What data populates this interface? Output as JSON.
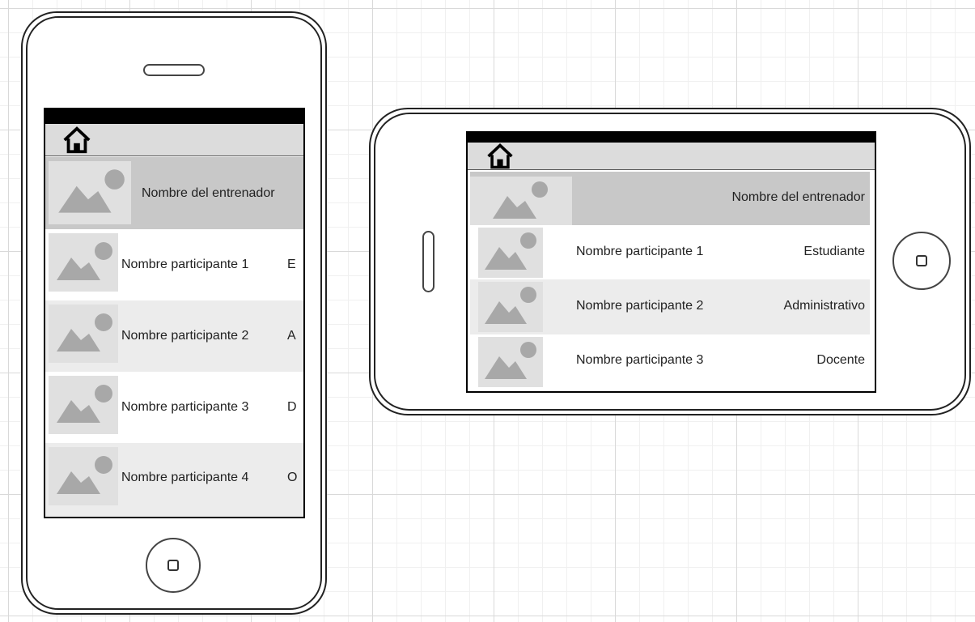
{
  "portrait": {
    "header": {
      "home_icon": "home-icon"
    },
    "trainer": {
      "name": "Nombre del entrenador"
    },
    "participants": [
      {
        "name": "Nombre participante 1",
        "role": "E"
      },
      {
        "name": "Nombre participante 2",
        "role": "A"
      },
      {
        "name": "Nombre participante 3",
        "role": "D"
      },
      {
        "name": "Nombre participante 4",
        "role": "O"
      }
    ]
  },
  "landscape": {
    "header": {
      "home_icon": "home-icon"
    },
    "trainer": {
      "name": "Nombre del entrenador"
    },
    "participants": [
      {
        "name": "Nombre participante 1",
        "role": "Estudiante"
      },
      {
        "name": "Nombre participante 2",
        "role": "Administrativo"
      },
      {
        "name": "Nombre participante 3",
        "role": "Docente"
      }
    ]
  },
  "colors": {
    "grid_major": "#d9d9d9",
    "grid_minor": "#f0f0f0",
    "trainer_row": "#c8c8c8",
    "alt_row": "#ececec",
    "placeholder": "#a8a8a8"
  }
}
